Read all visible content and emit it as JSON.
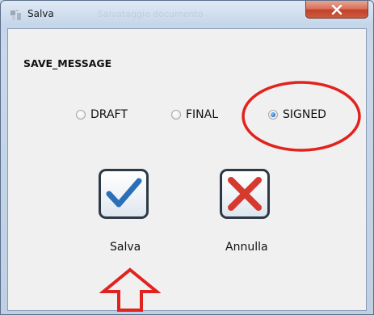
{
  "window": {
    "title": "Salva",
    "title_ghost": "Salvataggio documento"
  },
  "message": "SAVE_MESSAGE",
  "options": [
    {
      "label": "DRAFT",
      "selected": false
    },
    {
      "label": "FINAL",
      "selected": false
    },
    {
      "label": "SIGNED",
      "selected": true
    }
  ],
  "buttons": {
    "save_label": "Salva",
    "cancel_label": "Annulla"
  },
  "icons": {
    "app": "app-icon",
    "close": "close-icon",
    "save": "checkmark-icon",
    "cancel": "x-icon",
    "annotation": "arrow-up-icon"
  },
  "colors": {
    "accent_blue": "#2a6fb8",
    "close_red": "#c2412a",
    "annotation_red": "#e1231f",
    "cancel_red": "#d63a2f"
  }
}
